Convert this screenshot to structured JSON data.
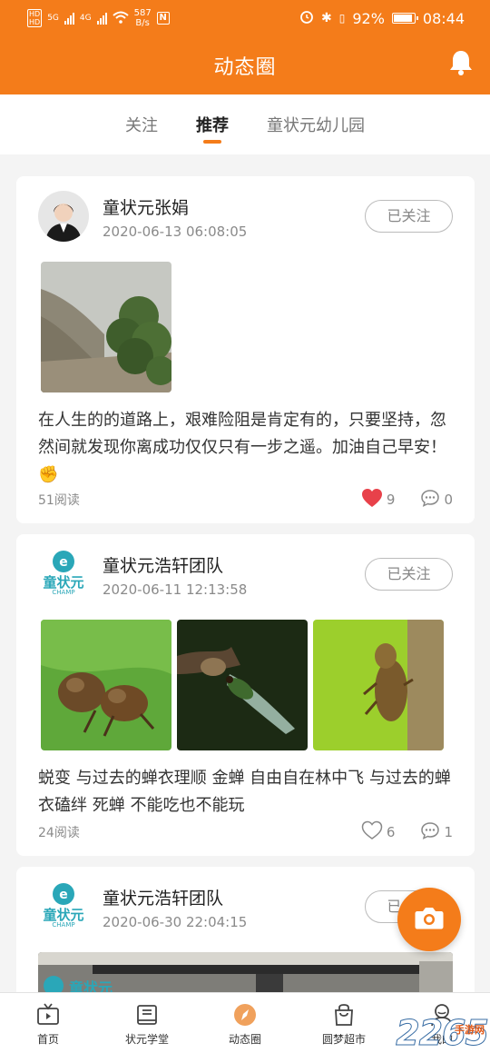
{
  "status_bar": {
    "net_speed": "587",
    "net_unit": "B/s",
    "battery": "92%",
    "time": "08:44",
    "network_a": "5G",
    "network_b": "4G"
  },
  "header": {
    "title": "动态圈"
  },
  "tabs": [
    {
      "label": "关注",
      "active": false
    },
    {
      "label": "推荐",
      "active": true
    },
    {
      "label": "童状元幼儿园",
      "active": false
    }
  ],
  "posts": [
    {
      "author": "童状元张娟",
      "time": "2020-06-13 06:08:05",
      "follow_label": "已关注",
      "content": "在人生的的道路上，艰难险阻是肯定有的，只要坚持，忽然间就发现你离成功仅仅只有一步之遥。加油自己早安！✊",
      "reads": "51阅读",
      "likes": "9",
      "comments": "0",
      "liked": true
    },
    {
      "author": "童状元浩轩团队",
      "time": "2020-06-11 12:13:58",
      "follow_label": "已关注",
      "content": "蜕变 与过去的蝉衣理顺 金蝉 自由自在林中飞 与过去的蝉衣磕绊 死蝉 不能吃也不能玩",
      "reads": "24阅读",
      "likes": "6",
      "comments": "1",
      "liked": false
    },
    {
      "author": "童状元浩轩团队",
      "time": "2020-06-30 22:04:15",
      "follow_label": "已关注",
      "banner_text": "童状元"
    }
  ],
  "logo_text": "童状元",
  "logo_sub": "CHAMP",
  "bottom_nav": [
    {
      "label": "首页",
      "icon": "tv-icon"
    },
    {
      "label": "状元学堂",
      "icon": "book-icon"
    },
    {
      "label": "动态圈",
      "icon": "compass-icon",
      "active": true
    },
    {
      "label": "圆梦超市",
      "icon": "shopping-bag-icon"
    },
    {
      "label": "我的",
      "icon": "user-icon"
    }
  ],
  "watermark": {
    "number": "2265",
    "site": "手游网"
  },
  "colors": {
    "brand": "#f47c1a",
    "like_red": "#e8414a",
    "teal": "#2aa7b8"
  }
}
